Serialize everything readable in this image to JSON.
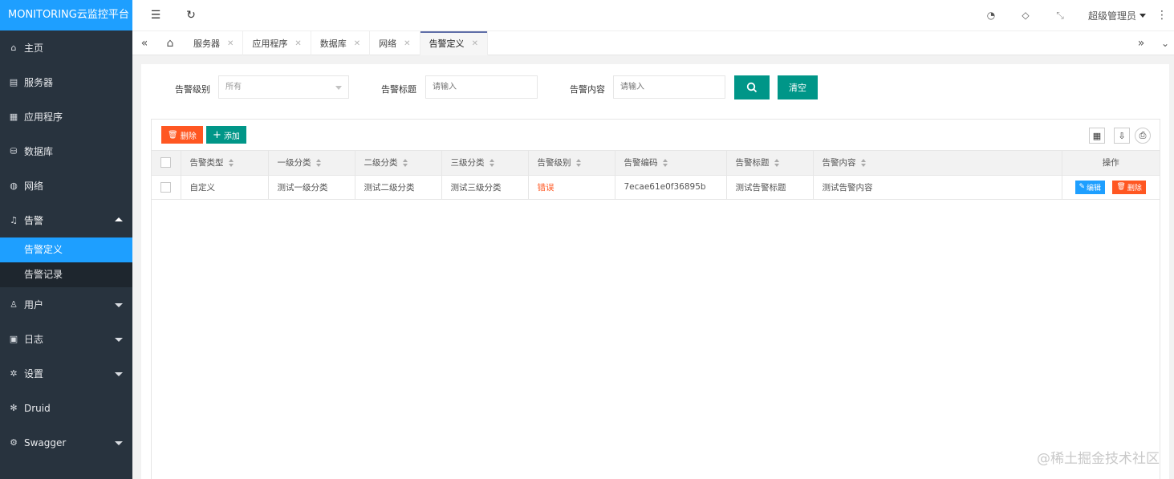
{
  "app": {
    "logo": "MONITORING云监控平台"
  },
  "sidebar": {
    "items": [
      {
        "label": "主页"
      },
      {
        "label": "服务器"
      },
      {
        "label": "应用程序"
      },
      {
        "label": "数据库"
      },
      {
        "label": "网络"
      },
      {
        "label": "告警"
      },
      {
        "label": "用户"
      },
      {
        "label": "日志"
      },
      {
        "label": "设置"
      },
      {
        "label": "Druid"
      },
      {
        "label": "Swagger"
      }
    ],
    "alarm_sub": [
      {
        "label": "告警定义"
      },
      {
        "label": "告警记录"
      }
    ]
  },
  "header": {
    "user": "超级管理员"
  },
  "tabs": [
    {
      "label": "服务器"
    },
    {
      "label": "应用程序"
    },
    {
      "label": "数据库"
    },
    {
      "label": "网络"
    },
    {
      "label": "告警定义"
    }
  ],
  "search": {
    "level_label": "告警级别",
    "level_value": "所有",
    "title_label": "告警标题",
    "title_placeholder": "请输入",
    "content_label": "告警内容",
    "content_placeholder": "请输入",
    "clear_label": "清空"
  },
  "toolbar": {
    "delete_label": "删除",
    "add_label": "添加"
  },
  "table": {
    "columns": [
      "告警类型",
      "一级分类",
      "二级分类",
      "三级分类",
      "告警级别",
      "告警编码",
      "告警标题",
      "告警内容",
      "操作"
    ],
    "rows": [
      {
        "type": "自定义",
        "cat1": "测试一级分类",
        "cat2": "测试二级分类",
        "cat3": "测试三级分类",
        "level": "错误",
        "code": "7ecae61e0f36895b",
        "title": "测试告警标题",
        "content": "测试告警内容",
        "edit": "编辑",
        "delete": "删除"
      }
    ]
  },
  "colors": {
    "primary": "#1e9fff",
    "green": "#009688",
    "danger": "#ff5722",
    "sidebar": "#28333e"
  },
  "watermark": "@稀土掘金技术社区"
}
